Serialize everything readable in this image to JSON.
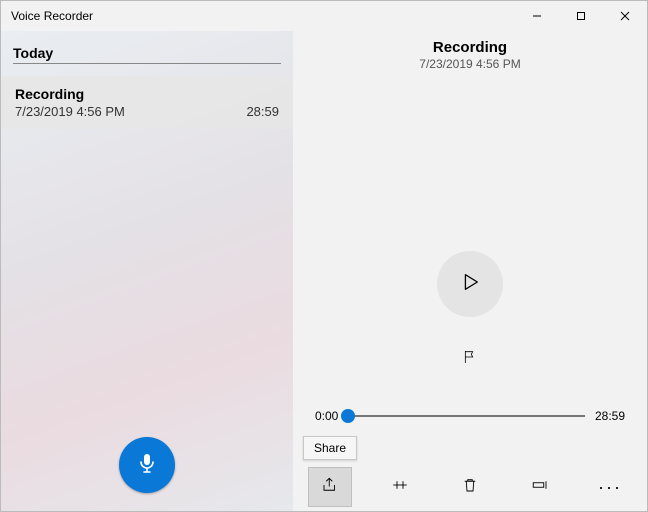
{
  "app": {
    "title": "Voice Recorder"
  },
  "sidebar": {
    "section_label": "Today",
    "items": [
      {
        "name": "Recording",
        "date": "7/23/2019 4:56 PM",
        "duration": "28:59"
      }
    ]
  },
  "detail": {
    "name": "Recording",
    "date": "7/23/2019 4:56 PM",
    "time_current": "0:00",
    "time_total": "28:59"
  },
  "toolbar": {
    "share_tooltip": "Share"
  }
}
